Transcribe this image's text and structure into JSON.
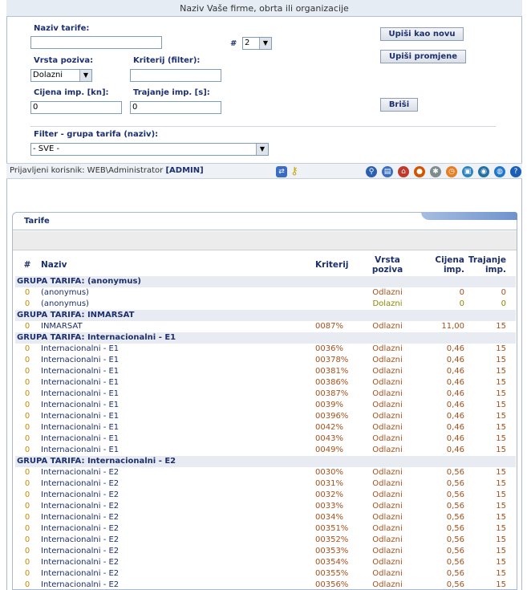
{
  "header": {
    "title": "Naziv Vaše firme, obrta ili organizacije"
  },
  "form": {
    "naziv_label": "Naziv tarife:",
    "naziv_value": "",
    "hash_label": "#",
    "hash_select": "2",
    "vrsta_label": "Vrsta poziva:",
    "vrsta_value": "Dolazni",
    "kriterij_label": "Kriterij (filter):",
    "kriterij_value": "",
    "cijena_label": "Cijena imp. [kn]:",
    "cijena_value": "0",
    "trajanje_label": "Trajanje imp. [s]:",
    "trajanje_value": "0",
    "filter_label": "Filter - grupa tarifa (naziv):",
    "filter_value": "- SVE -",
    "btn_new": "Upiši kao novu",
    "btn_change": "Upiši promjene",
    "btn_delete": "Briši"
  },
  "userbar": {
    "prefix": "Prijavljeni korisnik: WEB\\Administrator",
    "role": "[ADMIN]"
  },
  "panel": {
    "title": "Tarife"
  },
  "table": {
    "headers": {
      "num": "#",
      "name": "Naziv",
      "krit": "Kriterij",
      "vrsta": "Vrsta poziva",
      "cijena": "Cijena imp.",
      "trajanje": "Trajanje imp."
    },
    "groups": [
      {
        "title": "GRUPA TARIFA: (anonymus)",
        "rows": [
          {
            "num": "0",
            "name": "(anonymus)",
            "krit": "",
            "vrsta": "Odlazni",
            "cijena": "0",
            "trajanje": "0"
          },
          {
            "num": "0",
            "name": "(anonymus)",
            "krit": "",
            "vrsta": "Dolazni",
            "cijena": "0",
            "trajanje": "0"
          }
        ]
      },
      {
        "title": "GRUPA TARIFA: INMARSAT",
        "rows": [
          {
            "num": "0",
            "name": "INMARSAT",
            "krit": "0087%",
            "vrsta": "Odlazni",
            "cijena": "11,00",
            "trajanje": "15"
          }
        ]
      },
      {
        "title": "GRUPA TARIFA: Internacionalni - E1",
        "rows": [
          {
            "num": "0",
            "name": "Internacionalni - E1",
            "krit": "0036%",
            "vrsta": "Odlazni",
            "cijena": "0,46",
            "trajanje": "15"
          },
          {
            "num": "0",
            "name": "Internacionalni - E1",
            "krit": "00378%",
            "vrsta": "Odlazni",
            "cijena": "0,46",
            "trajanje": "15"
          },
          {
            "num": "0",
            "name": "Internacionalni - E1",
            "krit": "00381%",
            "vrsta": "Odlazni",
            "cijena": "0,46",
            "trajanje": "15"
          },
          {
            "num": "0",
            "name": "Internacionalni - E1",
            "krit": "00386%",
            "vrsta": "Odlazni",
            "cijena": "0,46",
            "trajanje": "15"
          },
          {
            "num": "0",
            "name": "Internacionalni - E1",
            "krit": "00387%",
            "vrsta": "Odlazni",
            "cijena": "0,46",
            "trajanje": "15"
          },
          {
            "num": "0",
            "name": "Internacionalni - E1",
            "krit": "0039%",
            "vrsta": "Odlazni",
            "cijena": "0,46",
            "trajanje": "15"
          },
          {
            "num": "0",
            "name": "Internacionalni - E1",
            "krit": "00396%",
            "vrsta": "Odlazni",
            "cijena": "0,46",
            "trajanje": "15"
          },
          {
            "num": "0",
            "name": "Internacionalni - E1",
            "krit": "0042%",
            "vrsta": "Odlazni",
            "cijena": "0,46",
            "trajanje": "15"
          },
          {
            "num": "0",
            "name": "Internacionalni - E1",
            "krit": "0043%",
            "vrsta": "Odlazni",
            "cijena": "0,46",
            "trajanje": "15"
          },
          {
            "num": "0",
            "name": "Internacionalni - E1",
            "krit": "0049%",
            "vrsta": "Odlazni",
            "cijena": "0,46",
            "trajanje": "15"
          }
        ]
      },
      {
        "title": "GRUPA TARIFA: Internacionalni - E2",
        "rows": [
          {
            "num": "0",
            "name": "Internacionalni - E2",
            "krit": "0030%",
            "vrsta": "Odlazni",
            "cijena": "0,56",
            "trajanje": "15"
          },
          {
            "num": "0",
            "name": "Internacionalni - E2",
            "krit": "0031%",
            "vrsta": "Odlazni",
            "cijena": "0,56",
            "trajanje": "15"
          },
          {
            "num": "0",
            "name": "Internacionalni - E2",
            "krit": "0032%",
            "vrsta": "Odlazni",
            "cijena": "0,56",
            "trajanje": "15"
          },
          {
            "num": "0",
            "name": "Internacionalni - E2",
            "krit": "0033%",
            "vrsta": "Odlazni",
            "cijena": "0,56",
            "trajanje": "15"
          },
          {
            "num": "0",
            "name": "Internacionalni - E2",
            "krit": "0034%",
            "vrsta": "Odlazni",
            "cijena": "0,56",
            "trajanje": "15"
          },
          {
            "num": "0",
            "name": "Internacionalni - E2",
            "krit": "00351%",
            "vrsta": "Odlazni",
            "cijena": "0,56",
            "trajanje": "15"
          },
          {
            "num": "0",
            "name": "Internacionalni - E2",
            "krit": "00352%",
            "vrsta": "Odlazni",
            "cijena": "0,56",
            "trajanje": "15"
          },
          {
            "num": "0",
            "name": "Internacionalni - E2",
            "krit": "00353%",
            "vrsta": "Odlazni",
            "cijena": "0,56",
            "trajanje": "15"
          },
          {
            "num": "0",
            "name": "Internacionalni - E2",
            "krit": "00354%",
            "vrsta": "Odlazni",
            "cijena": "0,56",
            "trajanje": "15"
          },
          {
            "num": "0",
            "name": "Internacionalni - E2",
            "krit": "00355%",
            "vrsta": "Odlazni",
            "cijena": "0,56",
            "trajanje": "15"
          },
          {
            "num": "0",
            "name": "Internacionalni - E2",
            "krit": "00356%",
            "vrsta": "Odlazni",
            "cijena": "0,56",
            "trajanje": "15"
          }
        ]
      }
    ]
  },
  "toolbar_icons": [
    {
      "name": "search-icon",
      "glyph": "⚲",
      "color": "#2b5fb0"
    },
    {
      "name": "book-icon",
      "glyph": "▤",
      "color": "#3a6fbf"
    },
    {
      "name": "home-icon",
      "glyph": "⌂",
      "color": "#c0392b"
    },
    {
      "name": "users-icon",
      "glyph": "●",
      "color": "#d35400"
    },
    {
      "name": "settings-icon",
      "glyph": "✱",
      "color": "#7f8c8d"
    },
    {
      "name": "clock-icon",
      "glyph": "◷",
      "color": "#e67e22"
    },
    {
      "name": "windows-icon",
      "glyph": "▣",
      "color": "#2e86c1"
    },
    {
      "name": "database-icon",
      "glyph": "◉",
      "color": "#2471a3"
    },
    {
      "name": "globe-icon",
      "glyph": "◍",
      "color": "#1f77d0"
    },
    {
      "name": "help-icon",
      "glyph": "?",
      "color": "#1a5fb4"
    }
  ]
}
